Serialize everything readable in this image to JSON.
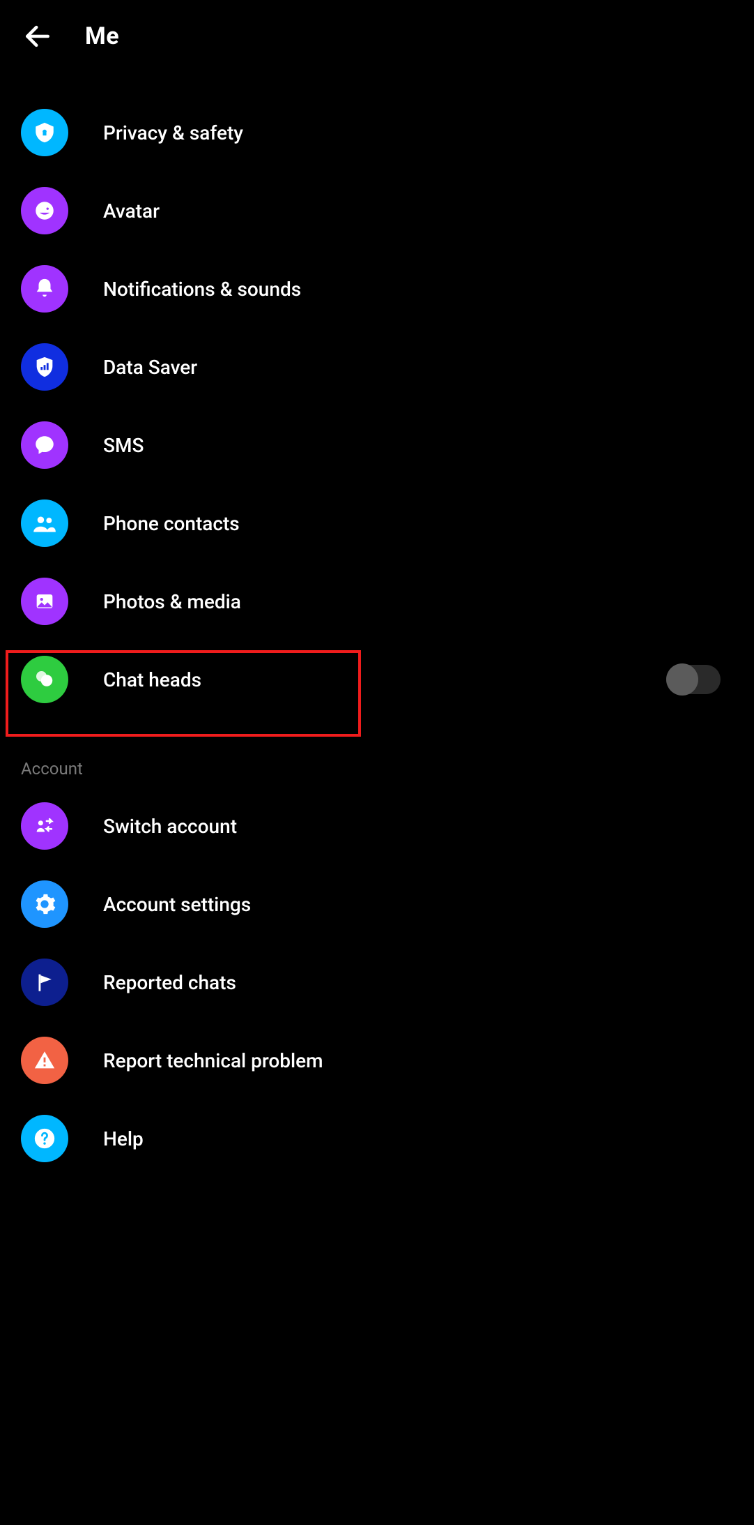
{
  "header": {
    "title": "Me"
  },
  "items": [
    {
      "label": "Privacy & safety"
    },
    {
      "label": "Avatar"
    },
    {
      "label": "Notifications & sounds"
    },
    {
      "label": "Data Saver"
    },
    {
      "label": "SMS"
    },
    {
      "label": "Phone contacts"
    },
    {
      "label": "Photos & media"
    },
    {
      "label": "Chat heads"
    }
  ],
  "section_account": {
    "label": "Account"
  },
  "account_items": [
    {
      "label": "Switch account"
    },
    {
      "label": "Account settings"
    },
    {
      "label": "Reported chats"
    },
    {
      "label": "Report technical problem"
    },
    {
      "label": "Help"
    }
  ],
  "colors": {
    "cyan": "#00b7ff",
    "purple": "#a033ff",
    "darkblue": "#102ee0",
    "green": "#2ecc40",
    "lightblue": "#1f95ff",
    "navy": "#0d1f8f",
    "orange": "#f26244"
  }
}
